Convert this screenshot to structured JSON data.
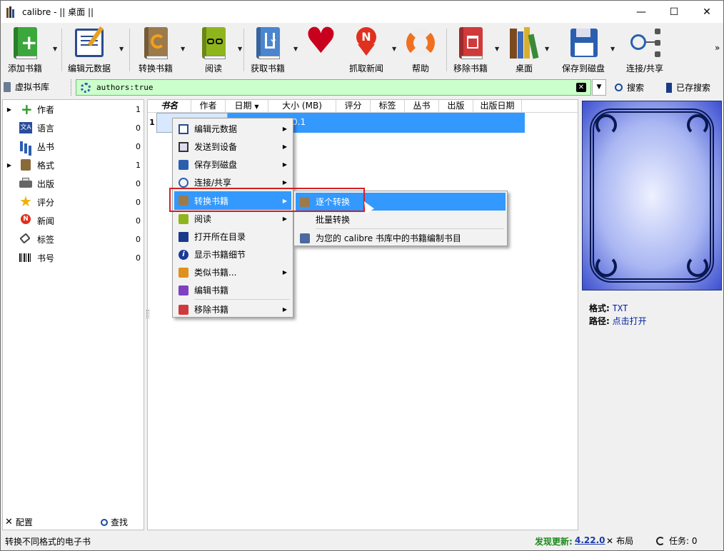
{
  "window": {
    "title": "calibre - || 桌面 ||",
    "minimize": "—",
    "maximize": "☐",
    "close": "✕"
  },
  "toolbar": {
    "buttons": [
      {
        "label": "添加书籍",
        "icon": "add-book-icon"
      },
      {
        "label": "编辑元数据",
        "icon": "edit-metadata-icon"
      },
      {
        "label": "转换书籍",
        "icon": "convert-books-icon"
      },
      {
        "label": "阅读",
        "icon": "read-book-icon"
      },
      {
        "label": "获取书籍",
        "icon": "get-books-icon"
      },
      {
        "label": "",
        "icon": "heart-icon"
      },
      {
        "label": "抓取新闻",
        "icon": "fetch-news-icon"
      },
      {
        "label": "帮助",
        "icon": "help-lifebuoy-icon"
      },
      {
        "label": "移除书籍",
        "icon": "remove-books-icon"
      },
      {
        "label": "桌面",
        "icon": "library-icon"
      },
      {
        "label": "保存到磁盘",
        "icon": "save-disk-icon"
      },
      {
        "label": "连接/共享",
        "icon": "connect-share-icon"
      }
    ],
    "overflow": "»"
  },
  "searchbar": {
    "virtual_library": "虚拟书库",
    "query": "authors:true",
    "search_btn": "搜索",
    "saved_search_btn": "已存搜索"
  },
  "tag_browser": {
    "items": [
      {
        "label": "作者",
        "count": "1",
        "expandable": true
      },
      {
        "label": "语言",
        "count": "0",
        "expandable": false
      },
      {
        "label": "丛书",
        "count": "0",
        "expandable": false
      },
      {
        "label": "格式",
        "count": "1",
        "expandable": true
      },
      {
        "label": "出版",
        "count": "0",
        "expandable": false
      },
      {
        "label": "评分",
        "count": "0",
        "expandable": false
      },
      {
        "label": "新闻",
        "count": "0",
        "expandable": false
      },
      {
        "label": "标签",
        "count": "0",
        "expandable": false
      },
      {
        "label": "书号",
        "count": "0",
        "expandable": false
      }
    ],
    "configure": "配置",
    "find": "查找"
  },
  "book_list": {
    "columns": [
      "书名",
      "作者",
      "日期",
      "大小 (MB)",
      "评分",
      "标签",
      "丛书",
      "出版",
      "出版日期"
    ],
    "row_number": "1",
    "row_size": "0.1"
  },
  "context_menu": {
    "items": [
      "编辑元数据",
      "发送到设备",
      "保存到磁盘",
      "连接/共享",
      "转换书籍",
      "阅读",
      "打开所在目录",
      "显示书籍细节",
      "类似书籍...",
      "编辑书籍",
      "移除书籍"
    ],
    "submenu": [
      "逐个转换",
      "批量转换",
      "为您的 calibre 书库中的书籍编制书目"
    ]
  },
  "details": {
    "format_label": "格式:",
    "format_value": "TXT",
    "path_label": "路径:",
    "path_value": "点击打开"
  },
  "statusbar": {
    "left": "转换不同格式的电子书",
    "update_label": "发现更新:",
    "update_version": "4.22.0",
    "layout": "布局",
    "jobs": "任务: 0"
  },
  "colors": {
    "accent": "#3399ff",
    "search_bg": "#ccffcc",
    "highlight_box": "#d42020"
  }
}
